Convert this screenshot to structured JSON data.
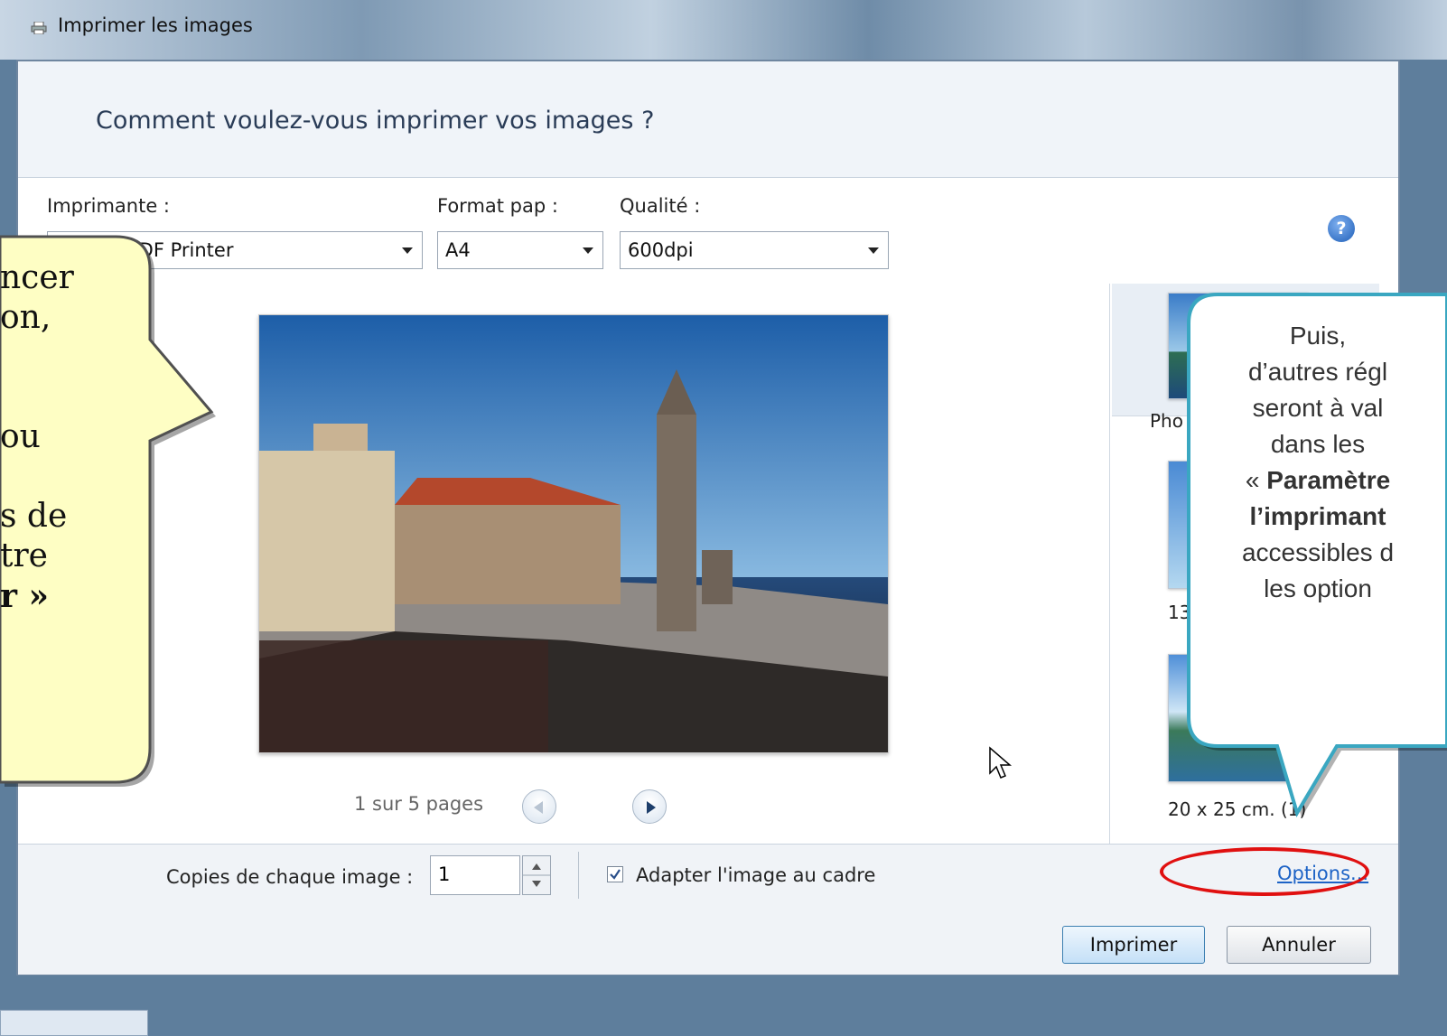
{
  "window": {
    "title": "Imprimer les images"
  },
  "header": {
    "question": "Comment voulez-vous imprimer vos images ?"
  },
  "printer": {
    "label": "Imprimante :",
    "value": "PDF Printer"
  },
  "paper": {
    "label": "Format pap :",
    "value": "A4"
  },
  "quality": {
    "label": "Qualité :",
    "value": "600dpi"
  },
  "help": {
    "icon": "help-icon",
    "glyph": "?"
  },
  "pager": {
    "text": "1 sur 5 pages"
  },
  "layouts": {
    "first": "Pho",
    "second": "13",
    "third": "20 x 25 cm. (1)"
  },
  "footer": {
    "copies_label": "Copies de chaque image :",
    "copies_value": "1",
    "fit_label": "Adapter l'image au cadre",
    "fit_checked": true,
    "options_link": "Options..."
  },
  "buttons": {
    "print": "Imprimer",
    "cancel": "Annuler"
  },
  "callout_left": {
    "lines": [
      "ncer",
      "on,",
      "",
      "",
      "ou",
      "",
      "s de",
      "tre",
      "r »"
    ]
  },
  "callout_right": {
    "line1": "Puis,",
    "line2": "d’autres régl",
    "line3": "seront à val",
    "line4": "dans les",
    "line5_prefix": "« ",
    "line5_bold": "Paramètre",
    "line6_bold": "l’imprimant",
    "line7": "accessibles d",
    "line8": "les option"
  }
}
